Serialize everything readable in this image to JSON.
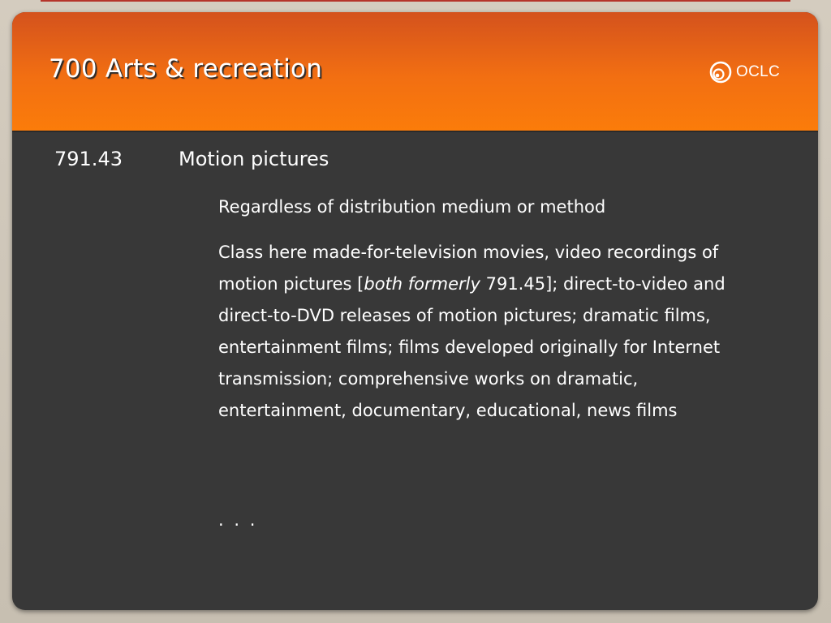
{
  "slide": {
    "title": "700 Arts & recreation",
    "logo_text": "OCLC"
  },
  "entry": {
    "number": "791.43",
    "heading": "Motion pictures",
    "note_scope": "Regardless of distribution medium or method",
    "class_here": {
      "before_italic": "Class here made-for-television movies, video recordings of motion pictures [",
      "italic": "both formerly",
      "after_italic": " 791.45]; direct-to-video and direct-to-DVD releases of motion pictures; dramatic films, entertainment films; films developed originally for Internet transmission; comprehensive works on dramatic, entertainment, documentary, educational, news films"
    },
    "ellipsis": ". . ."
  },
  "colors": {
    "header_orange": "#f26f12",
    "slide_background": "#383838",
    "page_background": "#cbc3b5",
    "top_rule": "#b5342a"
  },
  "icons": {
    "logo": "oclc-logo-icon"
  }
}
